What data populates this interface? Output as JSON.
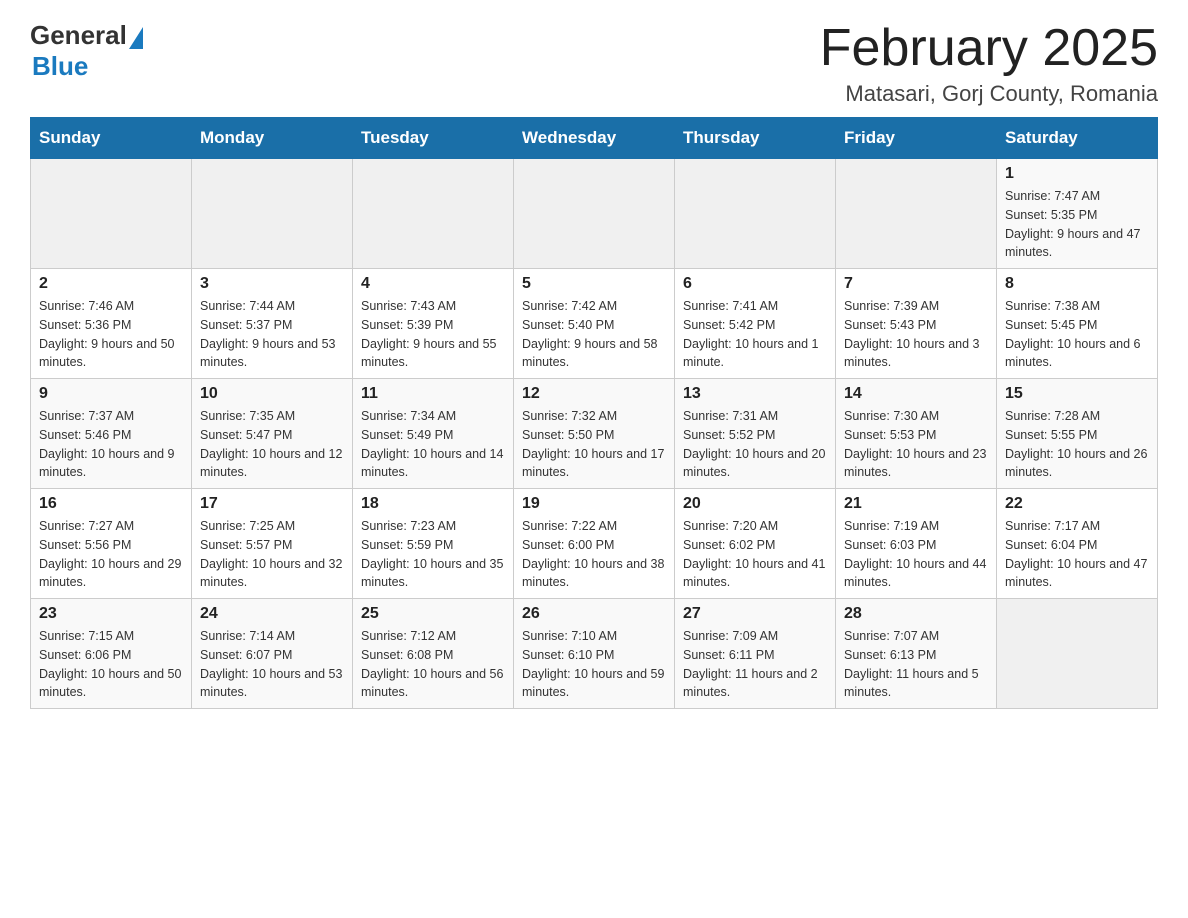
{
  "logo": {
    "general": "General",
    "blue": "Blue"
  },
  "title": "February 2025",
  "location": "Matasari, Gorj County, Romania",
  "days_of_week": [
    "Sunday",
    "Monday",
    "Tuesday",
    "Wednesday",
    "Thursday",
    "Friday",
    "Saturday"
  ],
  "weeks": [
    [
      null,
      null,
      null,
      null,
      null,
      null,
      {
        "day": "1",
        "sunrise": "7:47 AM",
        "sunset": "5:35 PM",
        "daylight": "9 hours and 47 minutes."
      }
    ],
    [
      {
        "day": "2",
        "sunrise": "7:46 AM",
        "sunset": "5:36 PM",
        "daylight": "9 hours and 50 minutes."
      },
      {
        "day": "3",
        "sunrise": "7:44 AM",
        "sunset": "5:37 PM",
        "daylight": "9 hours and 53 minutes."
      },
      {
        "day": "4",
        "sunrise": "7:43 AM",
        "sunset": "5:39 PM",
        "daylight": "9 hours and 55 minutes."
      },
      {
        "day": "5",
        "sunrise": "7:42 AM",
        "sunset": "5:40 PM",
        "daylight": "9 hours and 58 minutes."
      },
      {
        "day": "6",
        "sunrise": "7:41 AM",
        "sunset": "5:42 PM",
        "daylight": "10 hours and 1 minute."
      },
      {
        "day": "7",
        "sunrise": "7:39 AM",
        "sunset": "5:43 PM",
        "daylight": "10 hours and 3 minutes."
      },
      {
        "day": "8",
        "sunrise": "7:38 AM",
        "sunset": "5:45 PM",
        "daylight": "10 hours and 6 minutes."
      }
    ],
    [
      {
        "day": "9",
        "sunrise": "7:37 AM",
        "sunset": "5:46 PM",
        "daylight": "10 hours and 9 minutes."
      },
      {
        "day": "10",
        "sunrise": "7:35 AM",
        "sunset": "5:47 PM",
        "daylight": "10 hours and 12 minutes."
      },
      {
        "day": "11",
        "sunrise": "7:34 AM",
        "sunset": "5:49 PM",
        "daylight": "10 hours and 14 minutes."
      },
      {
        "day": "12",
        "sunrise": "7:32 AM",
        "sunset": "5:50 PM",
        "daylight": "10 hours and 17 minutes."
      },
      {
        "day": "13",
        "sunrise": "7:31 AM",
        "sunset": "5:52 PM",
        "daylight": "10 hours and 20 minutes."
      },
      {
        "day": "14",
        "sunrise": "7:30 AM",
        "sunset": "5:53 PM",
        "daylight": "10 hours and 23 minutes."
      },
      {
        "day": "15",
        "sunrise": "7:28 AM",
        "sunset": "5:55 PM",
        "daylight": "10 hours and 26 minutes."
      }
    ],
    [
      {
        "day": "16",
        "sunrise": "7:27 AM",
        "sunset": "5:56 PM",
        "daylight": "10 hours and 29 minutes."
      },
      {
        "day": "17",
        "sunrise": "7:25 AM",
        "sunset": "5:57 PM",
        "daylight": "10 hours and 32 minutes."
      },
      {
        "day": "18",
        "sunrise": "7:23 AM",
        "sunset": "5:59 PM",
        "daylight": "10 hours and 35 minutes."
      },
      {
        "day": "19",
        "sunrise": "7:22 AM",
        "sunset": "6:00 PM",
        "daylight": "10 hours and 38 minutes."
      },
      {
        "day": "20",
        "sunrise": "7:20 AM",
        "sunset": "6:02 PM",
        "daylight": "10 hours and 41 minutes."
      },
      {
        "day": "21",
        "sunrise": "7:19 AM",
        "sunset": "6:03 PM",
        "daylight": "10 hours and 44 minutes."
      },
      {
        "day": "22",
        "sunrise": "7:17 AM",
        "sunset": "6:04 PM",
        "daylight": "10 hours and 47 minutes."
      }
    ],
    [
      {
        "day": "23",
        "sunrise": "7:15 AM",
        "sunset": "6:06 PM",
        "daylight": "10 hours and 50 minutes."
      },
      {
        "day": "24",
        "sunrise": "7:14 AM",
        "sunset": "6:07 PM",
        "daylight": "10 hours and 53 minutes."
      },
      {
        "day": "25",
        "sunrise": "7:12 AM",
        "sunset": "6:08 PM",
        "daylight": "10 hours and 56 minutes."
      },
      {
        "day": "26",
        "sunrise": "7:10 AM",
        "sunset": "6:10 PM",
        "daylight": "10 hours and 59 minutes."
      },
      {
        "day": "27",
        "sunrise": "7:09 AM",
        "sunset": "6:11 PM",
        "daylight": "11 hours and 2 minutes."
      },
      {
        "day": "28",
        "sunrise": "7:07 AM",
        "sunset": "6:13 PM",
        "daylight": "11 hours and 5 minutes."
      },
      null
    ]
  ],
  "labels": {
    "sunrise": "Sunrise:",
    "sunset": "Sunset:",
    "daylight": "Daylight:"
  }
}
